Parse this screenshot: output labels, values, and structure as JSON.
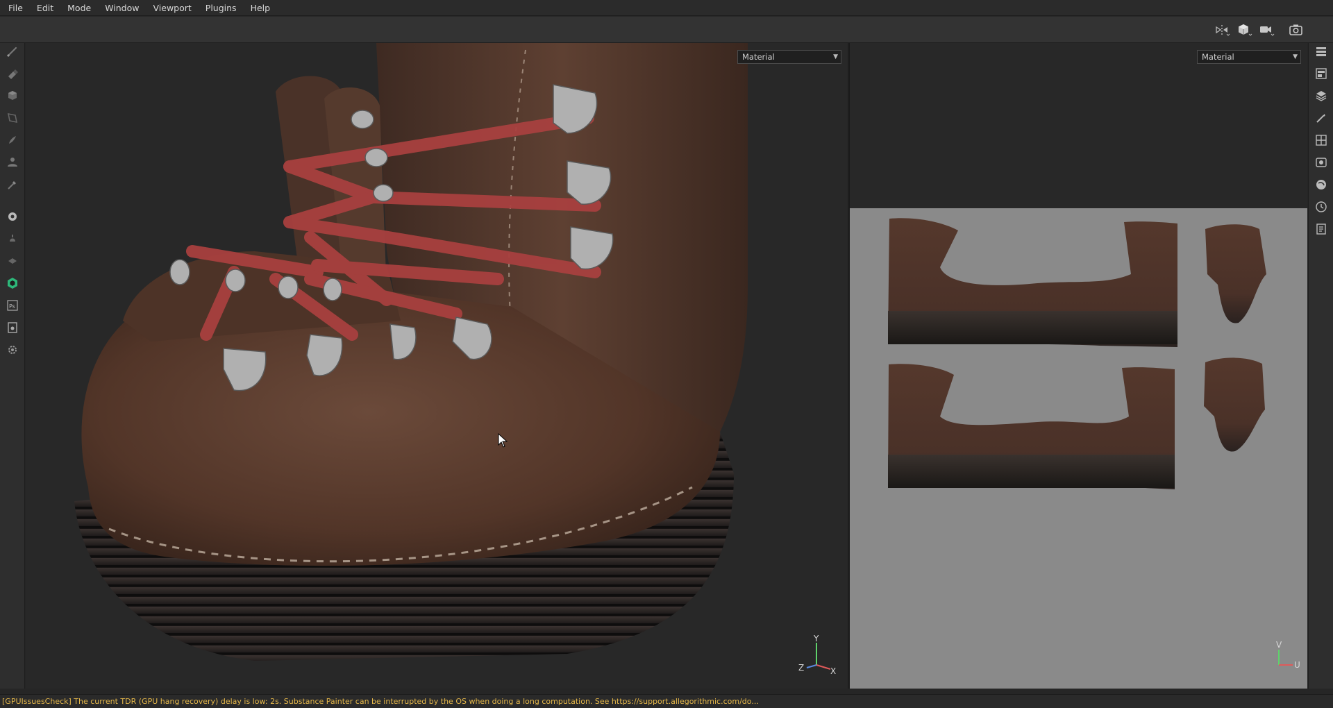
{
  "menu": {
    "file": "File",
    "edit": "Edit",
    "mode": "Mode",
    "window": "Window",
    "viewport": "Viewport",
    "plugins": "Plugins",
    "help": "Help"
  },
  "viewport3d": {
    "material_select": "Material",
    "gizmo": {
      "y": "Y",
      "x": "X",
      "z": "Z"
    }
  },
  "viewport2d": {
    "material_select": "Material",
    "gizmo": {
      "v": "V",
      "u": "U"
    }
  },
  "left_tools": [
    "paint-brush-icon",
    "eraser-icon",
    "projection-icon",
    "geometry-mask-icon",
    "smudge-icon",
    "clone-icon",
    "color-picker-icon",
    "bake-icon",
    "iray-icon",
    "sparse-icon",
    "substance-icon",
    "photoshop-icon",
    "export-icon",
    "settings-icon"
  ],
  "right_tools": [
    "texture-set-list-icon",
    "shelf-icon",
    "layers-icon",
    "properties-icon",
    "display-settings-icon",
    "viewer-settings-icon",
    "shader-settings-icon",
    "history-icon",
    "log-icon"
  ],
  "colors": {
    "leather": "#5a3a2a",
    "lace": "#a83a3a",
    "sole": "#2a2522",
    "uv_bg": "#8a8a8a",
    "status_warning": "#e6b84a"
  },
  "status": {
    "message": "[GPUIssuesCheck] The current TDR (GPU hang recovery) delay is low: 2s. Substance Painter can be interrupted by the OS when doing a long computation. See https://support.allegorithmic.com/do..."
  }
}
